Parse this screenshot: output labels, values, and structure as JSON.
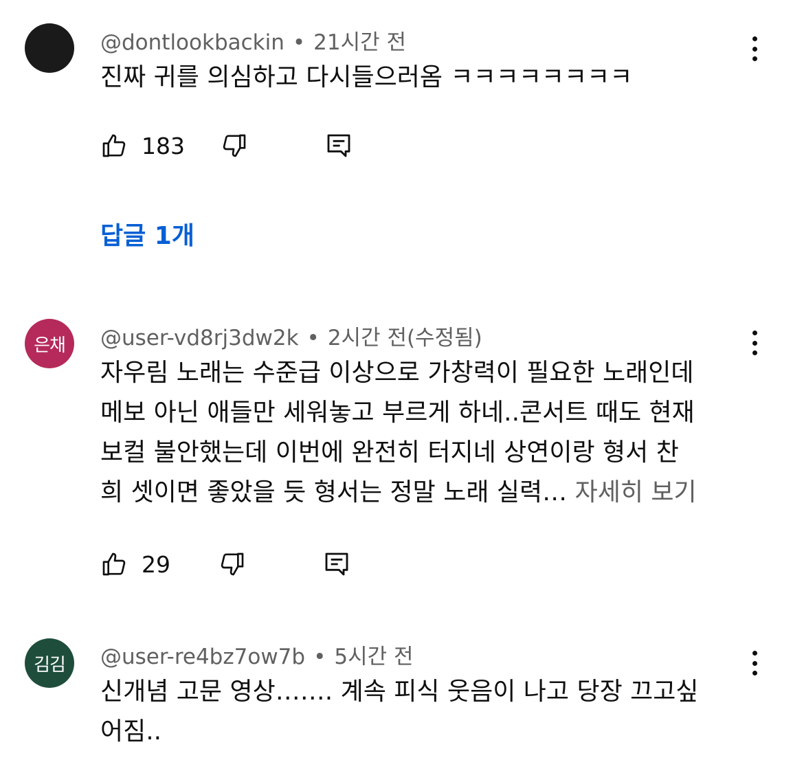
{
  "comments": [
    {
      "author": "@dontlookbackin",
      "time": "21시간 전",
      "avatar_text": "",
      "avatar_color": "#1a1a1a",
      "lines": [
        "진짜 귀를 의심하고 다시들으러옴 ㅋㅋㅋㅋㅋㅋㅋㅋ"
      ],
      "read_more": "",
      "likes": "183",
      "replies_label": "답글 1개"
    },
    {
      "author": "@user-vd8rj3dw2k",
      "time": "2시간 전(수정됨)",
      "avatar_text": "은채",
      "avatar_color": "#b52a5a",
      "lines": [
        "자우림 노래는 수준급 이상으로 가창력이 필요한 노래인데",
        "메보 아닌 애들만 세워놓고 부르게 하네..콘서트 때도 현재",
        "보컬 불안했는데 이번에 완전히 터지네  상연이랑 형서 찬",
        "희 셋이면 좋았을 듯 형서는 정말 노래 실력…"
      ],
      "read_more": "자세히 보기",
      "likes": "29"
    },
    {
      "author": "@user-re4bz7ow7b",
      "time": "5시간 전",
      "avatar_text": "김김",
      "avatar_color": "#1e4d3b",
      "lines": [
        "신개념 고문 영상……. 계속 피식 웃음이 나고 당장 끄고싶",
        "어짐.."
      ]
    }
  ],
  "icons": {
    "like": "thumbs-up-icon",
    "dislike": "thumbs-down-icon",
    "reply": "reply-icon",
    "more": "vertical-dots-icon"
  },
  "colors": {
    "text": "#0f0f0f",
    "secondary_text": "#606060",
    "link": "#065fd4"
  }
}
